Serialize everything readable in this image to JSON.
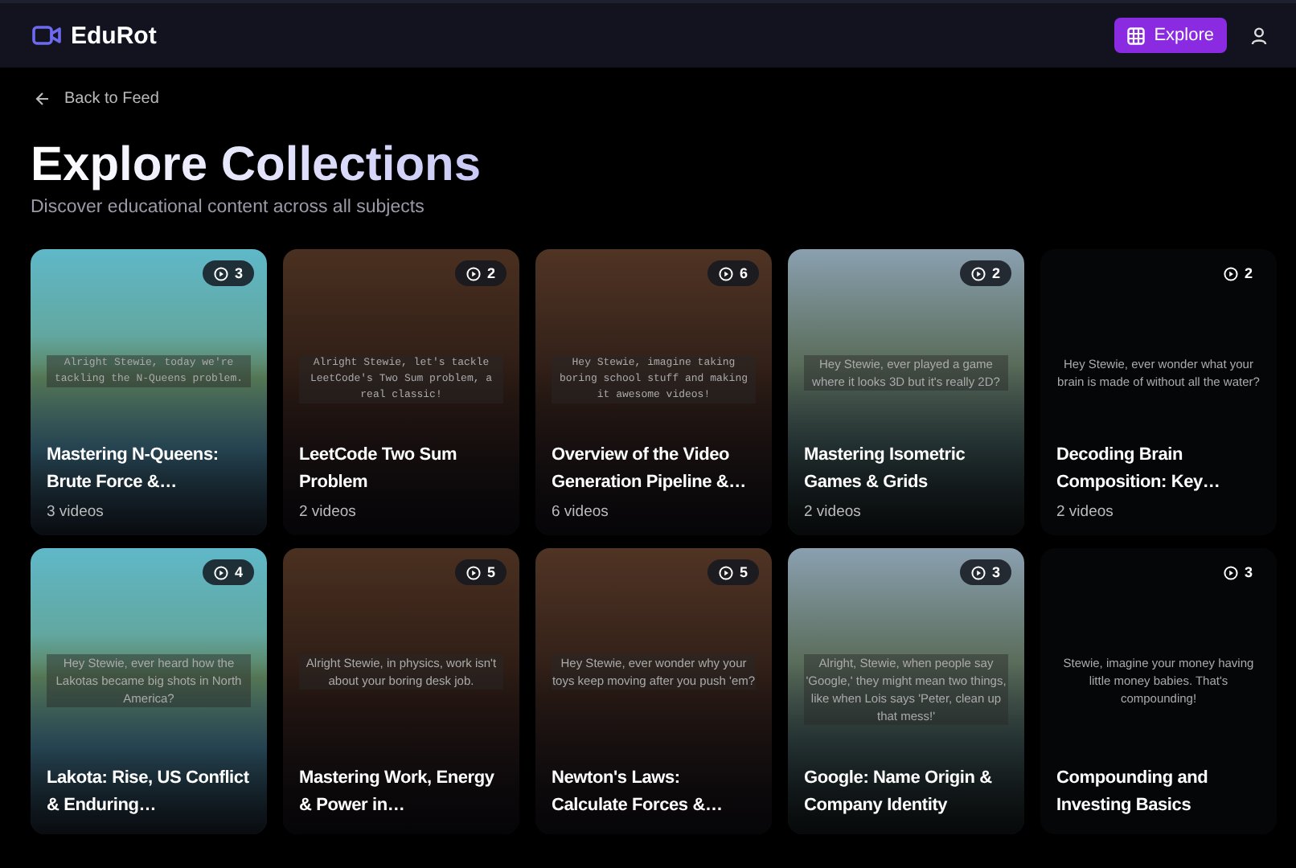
{
  "header": {
    "logo": "EduRot",
    "explore_button": {
      "label": "Explore",
      "selected": true
    }
  },
  "back_link": "Back to Feed",
  "title": "Explore Collections",
  "subtitle": "Discover educational content across all subjects",
  "collections": [
    {
      "kind": "photo",
      "count": "3",
      "caption": "Alright Stewie, today we're tackling the N-Queens problem.",
      "mono": true,
      "title": "Mastering N-Queens: Brute Force &…",
      "videos": "3 videos"
    },
    {
      "kind": "photo",
      "count": "2",
      "caption": "Alright Stewie, let's tackle LeetCode's Two Sum problem, a real classic!",
      "mono": true,
      "title": "LeetCode Two Sum Problem",
      "videos": "2 videos"
    },
    {
      "kind": "photo",
      "count": "6",
      "caption": "Hey Stewie, imagine taking boring school stuff and making it awesome videos!",
      "mono": true,
      "title": "Overview of the Video Generation Pipeline &…",
      "videos": "6 videos"
    },
    {
      "kind": "photo",
      "count": "2",
      "caption": "Hey Stewie, ever played a game where it looks 3D but it's really 2D?",
      "mono": false,
      "title": "Mastering Isometric Games & Grids",
      "videos": "2 videos"
    },
    {
      "kind": "blank",
      "count": "2",
      "caption": "Hey Stewie, ever wonder what your brain is made of without all the water?",
      "mono": false,
      "title": "Decoding Brain Composition: Key…",
      "videos": "2 videos"
    },
    {
      "kind": "photo",
      "count": "4",
      "caption": "Hey Stewie, ever heard how the Lakotas became big shots in North America?",
      "mono": false,
      "title": "Lakota: Rise, US Conflict & Enduring…"
    },
    {
      "kind": "photo",
      "count": "5",
      "caption": "Alright Stewie, in physics, work isn't about your boring desk job.",
      "mono": false,
      "title": "Mastering Work, Energy & Power in…"
    },
    {
      "kind": "photo",
      "count": "5",
      "caption": "Hey Stewie, ever wonder why your toys keep moving after you push 'em?",
      "mono": false,
      "title": "Newton's Laws: Calculate Forces &…"
    },
    {
      "kind": "photo",
      "count": "3",
      "caption": "Alright, Stewie, when people say 'Google,' they might mean two things, like when Lois says 'Peter, clean up that mess!'",
      "mono": false,
      "title": "Google: Name Origin & Company Identity"
    },
    {
      "kind": "blank",
      "count": "3",
      "caption": "Stewie, imagine your money having little money babies. That's compounding!",
      "mono": false,
      "title": "Compounding and Investing Basics"
    }
  ]
}
